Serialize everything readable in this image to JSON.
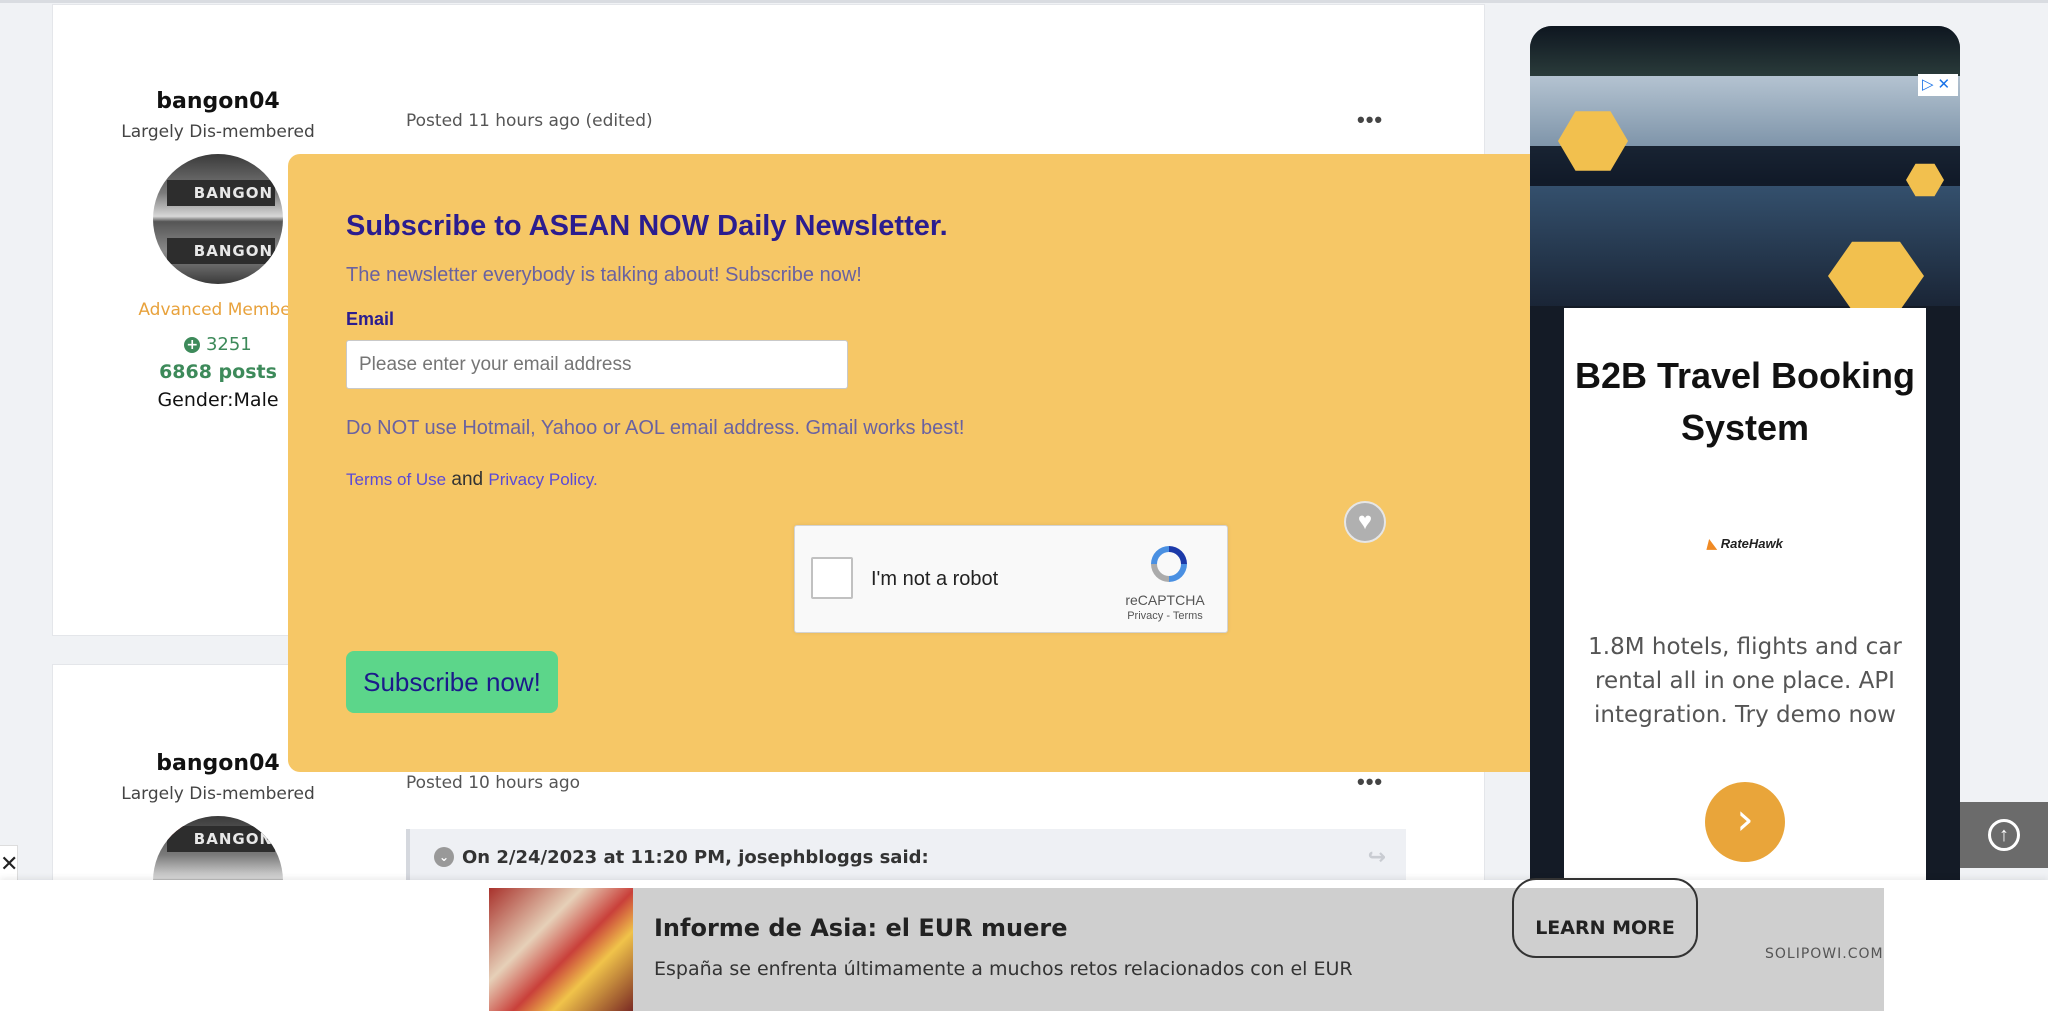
{
  "posts": [
    {
      "author": "bangon04",
      "title": "Largely Dis-membered",
      "avatar_text": "BANGON",
      "rank": "Advanced Member",
      "reputation": "3251",
      "post_count": "6868 posts",
      "gender": "Gender:Male",
      "posted": "Posted 11 hours ago (edited)"
    },
    {
      "author": "bangon04",
      "title": "Largely Dis-membered",
      "avatar_text": "BANGON",
      "posted": "Posted 10 hours ago",
      "quote": "On 2/24/2023 at 11:20 PM, josephbloggs said:"
    }
  ],
  "newsletter": {
    "title": "Subscribe to ASEAN NOW Daily Newsletter.",
    "subtitle": "The newsletter everybody is talking about! Subscribe now!",
    "email_label": "Email",
    "email_placeholder": "Please enter your email address",
    "warning": "Do NOT use Hotmail, Yahoo or AOL email address. Gmail works best!",
    "terms_link": "Terms of Use",
    "and_text": "and",
    "privacy_link": "Privacy Policy.",
    "recaptcha_label": "I'm not a robot",
    "recaptcha_brand": "reCAPTCHA",
    "recaptcha_links": "Privacy - Terms",
    "submit_label": "Subscribe now!",
    "heart_icon": "♥"
  },
  "side_ad": {
    "title": "B2B Travel Booking System",
    "logo": "RateHawk",
    "description": "1.8M hotels, flights and car rental all in one place. API integration. Try demo now",
    "go_icon": "›",
    "ad_choices": "▷✕"
  },
  "bottom_ad": {
    "title": "Informe de Asia: el EUR muere",
    "description": "España se enfrenta últimamente a muchos retos relacionados con el EUR",
    "button": "LEARN MORE",
    "domain": "SOLIPOWI.COM"
  },
  "controls": {
    "scroll_top_icon": "↑",
    "close_left_icon": "✕",
    "more_icon": "•••",
    "plus_icon": "+",
    "quote_icon": "⌄",
    "share_icon": "↪"
  },
  "colors": {
    "modal_bg": "#f6c766",
    "title": "#2b1d8f",
    "submit_bg": "#5cd68a",
    "rank": "#e8a23c",
    "reputation": "#3d8a5a"
  }
}
